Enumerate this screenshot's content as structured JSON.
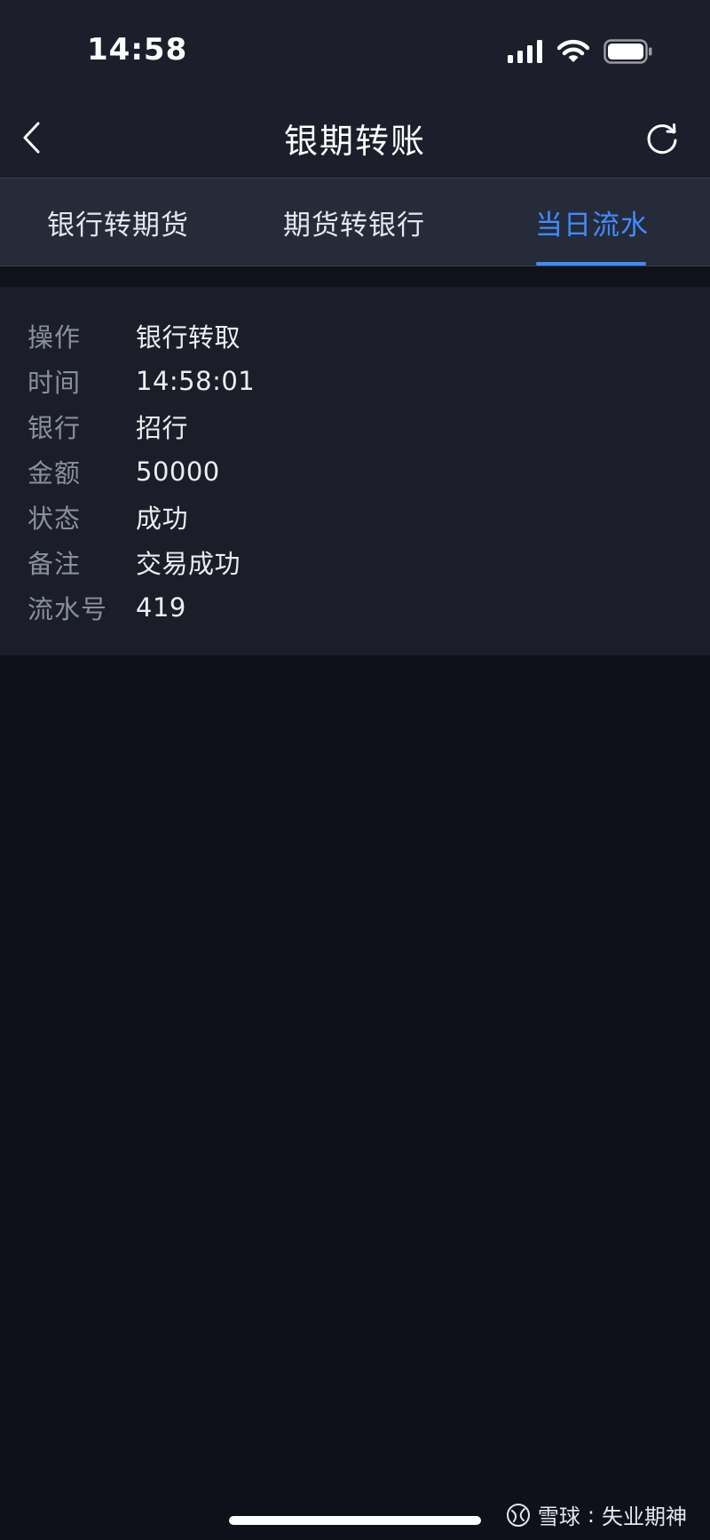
{
  "status_bar": {
    "time": "14:58"
  },
  "nav": {
    "title": "银期转账"
  },
  "tabs": [
    {
      "label": "银行转期货",
      "active": false
    },
    {
      "label": "期货转银行",
      "active": false
    },
    {
      "label": "当日流水",
      "active": true
    }
  ],
  "record": {
    "rows": [
      {
        "label": "操作",
        "value": "银行转取"
      },
      {
        "label": "时间",
        "value": "14:58:01"
      },
      {
        "label": "银行",
        "value": "招行"
      },
      {
        "label": "金额",
        "value": "50000"
      },
      {
        "label": "状态",
        "value": "成功"
      },
      {
        "label": "备注",
        "value": "交易成功"
      },
      {
        "label": "流水号",
        "value": "419"
      }
    ]
  },
  "watermark": {
    "brand": "雪球",
    "separator": ":",
    "author": "失业期神"
  },
  "colors": {
    "accent": "#3f8cff",
    "header_bg": "#1c1f2b",
    "tab_bg": "#262b3a",
    "card_bg": "#1b1e29",
    "page_bg": "#0e111a"
  }
}
